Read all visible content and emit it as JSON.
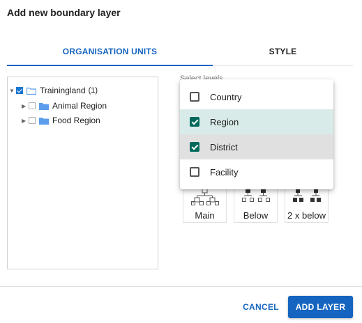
{
  "dialog": {
    "title": "Add new boundary layer"
  },
  "tabs": [
    {
      "label": "ORGANISATION UNITS",
      "active": true
    },
    {
      "label": "STYLE",
      "active": false
    }
  ],
  "tree": {
    "root": {
      "label": "Trainingland",
      "count": "(1)",
      "checked": true
    },
    "children": [
      {
        "label": "Animal Region",
        "checked": false
      },
      {
        "label": "Food Region",
        "checked": false
      }
    ]
  },
  "select_label": "Select levels",
  "dropdown": {
    "options": [
      {
        "label": "Country",
        "checked": false
      },
      {
        "label": "Region",
        "checked": true
      },
      {
        "label": "District",
        "checked": true
      },
      {
        "label": "Facility",
        "checked": false
      }
    ]
  },
  "level_buttons": [
    {
      "label": "Main"
    },
    {
      "label": "Below"
    },
    {
      "label": "2 x below"
    }
  ],
  "footer": {
    "cancel_label": "CANCEL",
    "add_label": "ADD LAYER"
  },
  "colors": {
    "primary": "#1565c0",
    "checkbox_checked": "#00695c",
    "selected_row": "#d9ebe8",
    "hover_row": "#e0e0e0",
    "folder": "#5c9ded"
  }
}
